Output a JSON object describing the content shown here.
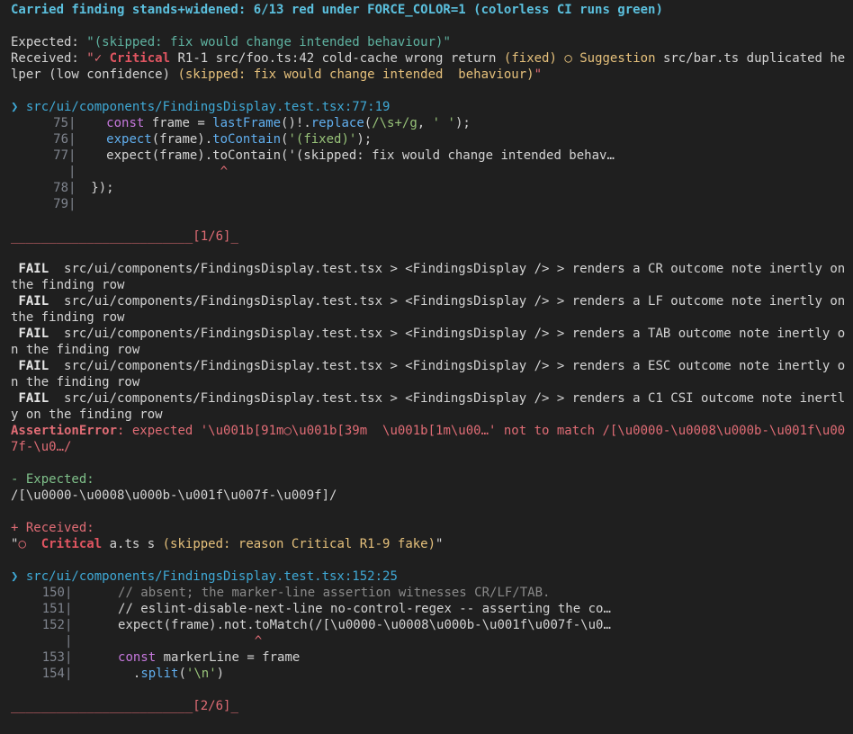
{
  "header": {
    "title": "Carried finding stands+widened: 6/13 red under FORCE_COLOR=1 (colorless CI runs green)"
  },
  "assert1": {
    "expected_label": "Expected: ",
    "expected_value": "\"(skipped: fix would change intended behaviour)\"",
    "received_label": "Received: ",
    "recv_q": "\"",
    "recv_check": "✓ ",
    "recv_critical": "Critical",
    "recv_text1": " R1-1 src/foo.ts:42 cold-cache wrong return ",
    "recv_fixed": "(fixed)",
    "recv_circle": " ○ ",
    "recv_suggestion": "Suggestion",
    "recv_text2": " src/bar.ts duplicated he",
    "recv_text3": "lper (low confidence) ",
    "recv_skipped": "(skipped: fix would change intended  behaviour)",
    "recv_end": "\""
  },
  "location1": {
    "arrow": "❯ ",
    "path": "src/ui/components/FindingsDisplay.test.tsx:77:19"
  },
  "code1": {
    "l75_num": "75",
    "l76_num": "76",
    "l77_num": "77",
    "l78_num": "78",
    "l79_num": "79",
    "l75_const": "const",
    "l75_a": " frame = ",
    "l75_fn": "lastFrame",
    "l75_b": "()!.",
    "l75_fn2": "replace",
    "l75_c": "(",
    "l75_re": "/\\s+/g",
    "l75_d": ", ",
    "l75_str": "' '",
    "l75_e": ");",
    "l76_fn": "expect",
    "l76_a": "(frame).",
    "l76_fn2": "toContain",
    "l76_b": "(",
    "l76_str": "'(fixed)'",
    "l76_c": ");",
    "l77_text": "expect(frame).toContain('(skipped: fix would change intended behav…",
    "caret": "^",
    "l78_text": "});"
  },
  "separator1": {
    "line": "________________________",
    "label": "[1/6]",
    "end": "_"
  },
  "failures": [
    {
      "tag": "FAIL",
      "text": "  src/ui/components/FindingsDisplay.test.tsx > <FindingsDisplay /> > renders a CR outcome note inertly on",
      "wrap": "the finding row"
    },
    {
      "tag": "FAIL",
      "text": "  src/ui/components/FindingsDisplay.test.tsx > <FindingsDisplay /> > renders a LF outcome note inertly on",
      "wrap": "the finding row"
    },
    {
      "tag": "FAIL",
      "text": "  src/ui/components/FindingsDisplay.test.tsx > <FindingsDisplay /> > renders a TAB outcome note inertly o",
      "wrap": "n the finding row"
    },
    {
      "tag": "FAIL",
      "text": "  src/ui/components/FindingsDisplay.test.tsx > <FindingsDisplay /> > renders a ESC outcome note inertly o",
      "wrap": "n the finding row"
    },
    {
      "tag": "FAIL",
      "text": "  src/ui/components/FindingsDisplay.test.tsx > <FindingsDisplay /> > renders a C1 CSI outcome note inertl",
      "wrap": "y on the finding row"
    }
  ],
  "assertion_error": {
    "label": "AssertionError",
    "line1": ": expected '\\u001b[91m○\\u001b[39m  \\u001b[1m\\u00…' not to match /[\\u0000-\\u0008\\u000b-\\u001f\\u00",
    "line2": "7f-\\u0…/"
  },
  "diff": {
    "expected_label": "- Expected:",
    "expected_value": "/[\\u0000-\\u0008\\u000b-\\u001f\\u007f-\\u009f]/",
    "received_label": "+ Received:",
    "recv_q": "\"",
    "recv_circle": "○",
    "recv_critical": "Critical",
    "recv_text": " a.ts s ",
    "recv_skipped": "(skipped: reason Critical R1-9 fake)",
    "recv_end": "\""
  },
  "location2": {
    "arrow": "❯ ",
    "path": "src/ui/components/FindingsDisplay.test.tsx:152:25"
  },
  "code2": {
    "l150_num": "150",
    "l151_num": "151",
    "l152_num": "152",
    "l153_num": "153",
    "l154_num": "154",
    "l150_text": "// absent; the marker-line assertion witnesses CR/LF/TAB.",
    "l151_text": "// eslint-disable-next-line no-control-regex -- asserting the co…",
    "l152_text": "expect(frame).not.toMatch(/[\\u0000-\\u0008\\u000b-\\u001f\\u007f-\\u0…",
    "caret": "^",
    "l153_const": "const",
    "l153_text": " markerLine = frame",
    "l154_a": "  .",
    "l154_fn": "split",
    "l154_b": "(",
    "l154_str": "'\\n'",
    "l154_c": ")"
  },
  "separator2": {
    "line": "________________________",
    "label": "[2/6]",
    "end": "_"
  },
  "colors": {
    "background": "#1f1f1f",
    "title": "#5bc0de",
    "error_red": "#e06c75",
    "expected_green": "#5fb3a1",
    "yellow": "#e5c07b"
  }
}
